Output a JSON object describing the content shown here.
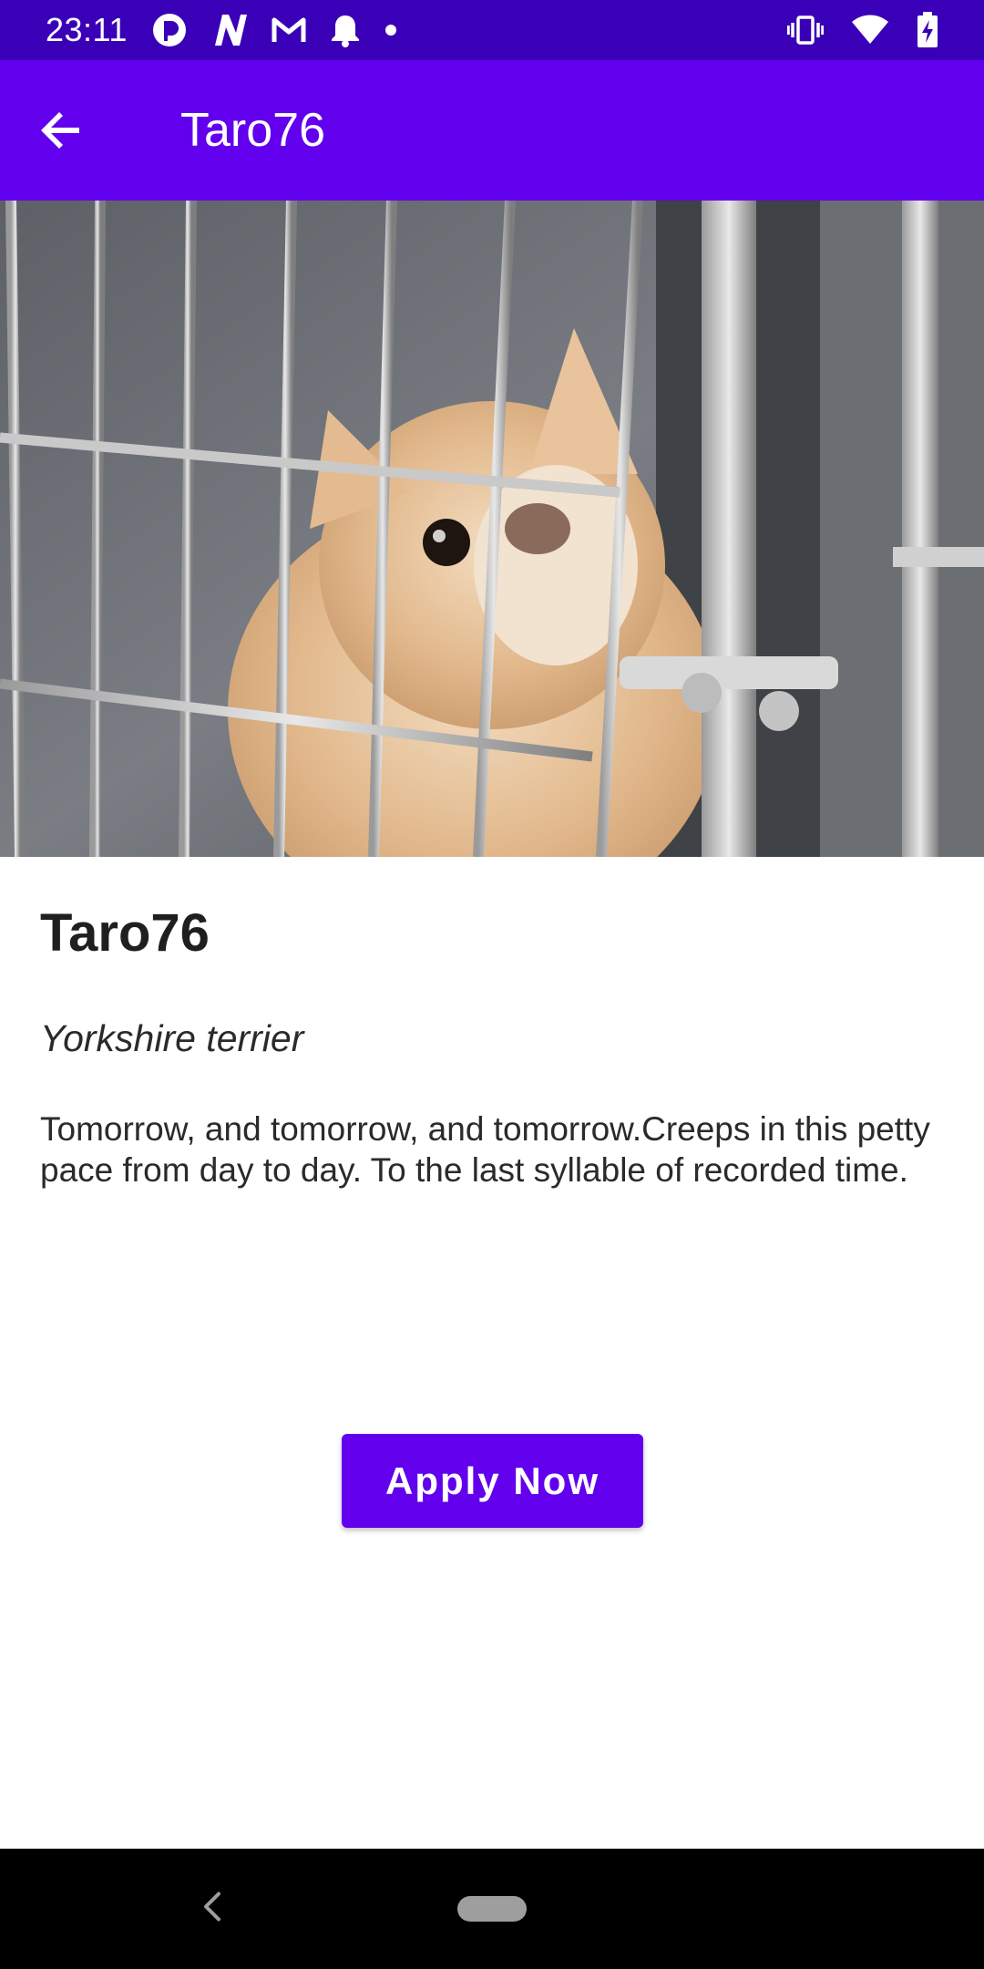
{
  "status_bar": {
    "time": "23:11",
    "left_icons": [
      "pocket-casts-icon",
      "n-app-icon",
      "gmail-icon",
      "bell-icon",
      "dot-icon"
    ],
    "right_icons": [
      "vibrate-icon",
      "wifi-icon",
      "battery-charging-icon"
    ]
  },
  "app_bar": {
    "title": "Taro76",
    "back_icon": "arrow-back-icon"
  },
  "hero": {
    "description_icon": "pet-photo"
  },
  "pet": {
    "name": "Taro76",
    "breed": "Yorkshire terrier",
    "description": "Tomorrow, and tomorrow, and tomorrow.Creeps in this petty pace from day to day. To the last syllable of recorded time."
  },
  "actions": {
    "apply_label": "Apply Now"
  },
  "colors": {
    "status_bar": "#3a00b8",
    "primary": "#6200ee",
    "nav_bar": "#000000"
  }
}
